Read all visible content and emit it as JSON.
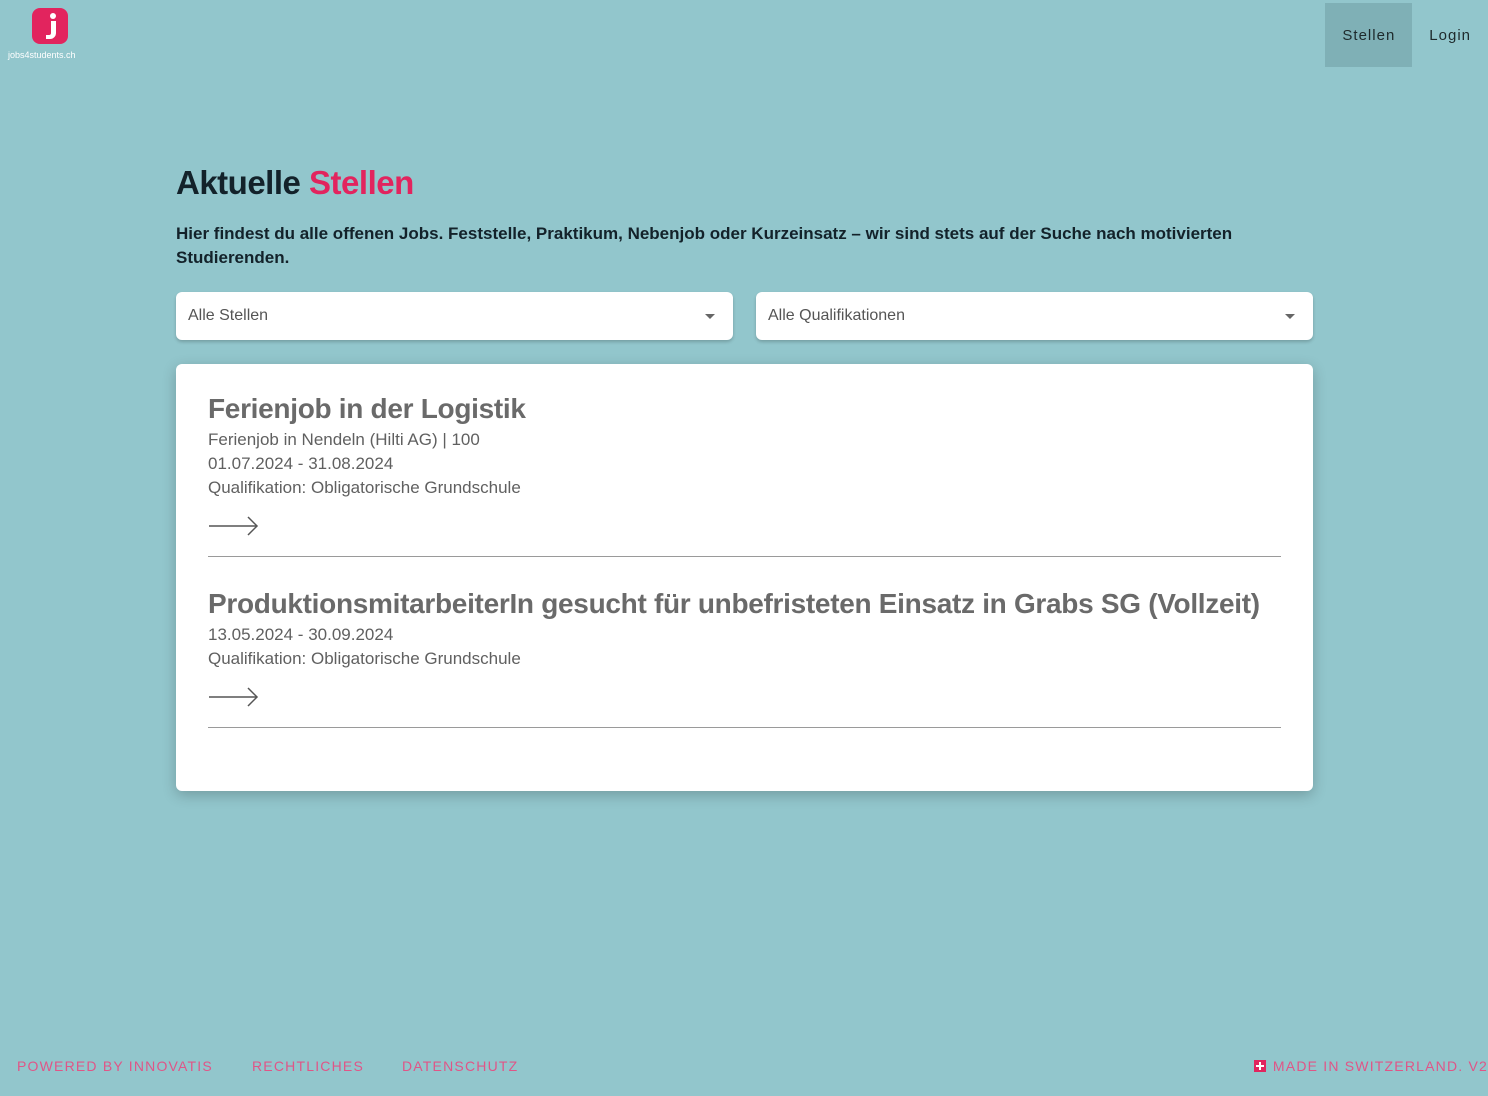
{
  "header": {
    "logo_letter": "j",
    "logo_text": "jobs4students.ch",
    "nav": [
      {
        "label": "Stellen",
        "active": true
      },
      {
        "label": "Login",
        "active": false
      }
    ]
  },
  "page": {
    "title_part1": "Aktuelle",
    "title_part2": "Stellen",
    "intro": "Hier findest du alle offenen Jobs. Feststelle, Praktikum, Nebenjob oder Kurzeinsatz – wir sind stets auf der Suche nach motivierten Studierenden."
  },
  "filters": {
    "positions": "Alle Stellen",
    "qualifications": "Alle Qualifikationen"
  },
  "jobs": [
    {
      "title": "Ferienjob in der Logistik",
      "subtitle": "Ferienjob in Nendeln (Hilti AG) | 100",
      "dates": "01.07.2024 - 31.08.2024",
      "qualification": "Qualifikation: Obligatorische Grundschule"
    },
    {
      "title": "ProduktionsmitarbeiterIn gesucht für unbefristeten Einsatz in Grabs SG (Vollzeit)",
      "dates": "13.05.2024 - 30.09.2024",
      "qualification": "Qualifikation: Obligatorische Grundschule"
    }
  ],
  "footer": {
    "links": [
      "POWERED BY INNOVATIS",
      "RECHTLICHES",
      "DATENSCHUTZ"
    ],
    "made_in": "MADE IN SWITZERLAND. V2"
  },
  "colors": {
    "background": "#92c6cc",
    "accent": "#e2245e",
    "nav_active": "#7fb0b6"
  }
}
